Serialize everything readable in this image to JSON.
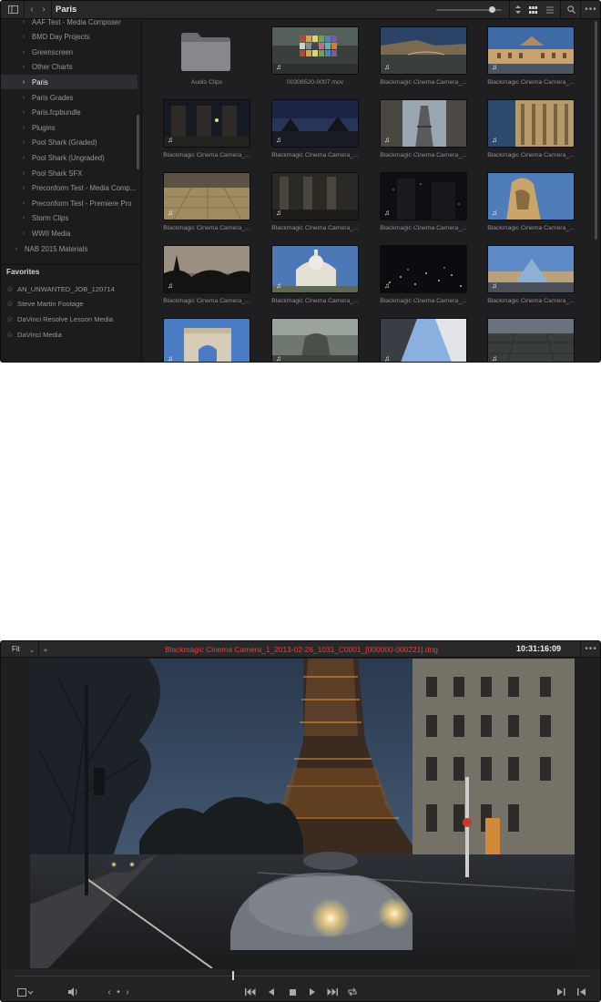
{
  "browser": {
    "path_title": "Paris",
    "tree": [
      {
        "label": "AAF Test - Media Composer",
        "selected": false
      },
      {
        "label": "BMD Day Projects",
        "selected": false
      },
      {
        "label": "Greenscreen",
        "selected": false
      },
      {
        "label": "Other Charts",
        "selected": false
      },
      {
        "label": "Paris",
        "selected": true
      },
      {
        "label": "Paris Grades",
        "selected": false
      },
      {
        "label": "Paris.fcpbundle",
        "selected": false
      },
      {
        "label": "Plugins",
        "selected": false
      },
      {
        "label": "Pool Shark (Graded)",
        "selected": false
      },
      {
        "label": "Pool Shark (Ungraded)",
        "selected": false
      },
      {
        "label": "Pool Shark SFX",
        "selected": false
      },
      {
        "label": "Preconform Test - Media Comp...",
        "selected": false
      },
      {
        "label": "Preconform Test - Premiere Pro",
        "selected": false
      },
      {
        "label": "Storm Clips",
        "selected": false
      },
      {
        "label": "WWII Media",
        "selected": false
      },
      {
        "label": "NAB 2015 Materials",
        "selected": false
      }
    ],
    "favorites_header": "Favorites",
    "favorites": [
      "AN_UNWANTED_JOB_120714",
      "Steve Martin Footage",
      "DaVinci Resolve Lesson Media",
      "DaVinci Media"
    ],
    "clips": [
      {
        "caption": "Audio Clips",
        "kind": "folder"
      },
      {
        "caption": "00308520-0007.mov",
        "kind": "chart"
      },
      {
        "caption": "Blackmagic Cinema Camera_...",
        "kind": "seine"
      },
      {
        "caption": "Blackmagic Cinema Camera_...",
        "kind": "palace"
      },
      {
        "caption": "Blackmagic Cinema Camera_...",
        "kind": "arcade"
      },
      {
        "caption": "Blackmagic Cinema Camera_...",
        "kind": "dusk"
      },
      {
        "caption": "Blackmagic Cinema Camera_...",
        "kind": "eiffel"
      },
      {
        "caption": "Blackmagic Cinema Camera_...",
        "kind": "columns"
      },
      {
        "caption": "Blackmagic Cinema Camera_...",
        "kind": "plaza"
      },
      {
        "caption": "Blackmagic Cinema Camera_...",
        "kind": "courtyard"
      },
      {
        "caption": "Blackmagic Cinema Camera_...",
        "kind": "night"
      },
      {
        "caption": "Blackmagic Cinema Camera_...",
        "kind": "statue"
      },
      {
        "caption": "Blackmagic Cinema Camera_...",
        "kind": "sunset"
      },
      {
        "caption": "Blackmagic Cinema Camera_...",
        "kind": "basilica"
      },
      {
        "caption": "Blackmagic Cinema Camera_...",
        "kind": "citylights"
      },
      {
        "caption": "Blackmagic Cinema Camera_...",
        "kind": "pyramid"
      },
      {
        "caption": "",
        "kind": "arch"
      },
      {
        "caption": "",
        "kind": "fountain"
      },
      {
        "caption": "",
        "kind": "tower"
      },
      {
        "caption": "",
        "kind": "aerial"
      }
    ],
    "clip_audio_icon": "music-note-icon",
    "zoom_level": 0.85
  },
  "viewer": {
    "fit_label": "Fit",
    "clip_name": "Blackmagic Cinema Camera_1_2013-02-26_1031_C0001_[000000-000221].dng",
    "timecode": "10:31:16:09",
    "playhead_position": 0.38
  },
  "colors": {
    "panel_bg": "#1f1f22",
    "toolbar_bg": "#28282b",
    "selected_row": "#2e2e32",
    "clip_name_red": "#e8403a"
  }
}
